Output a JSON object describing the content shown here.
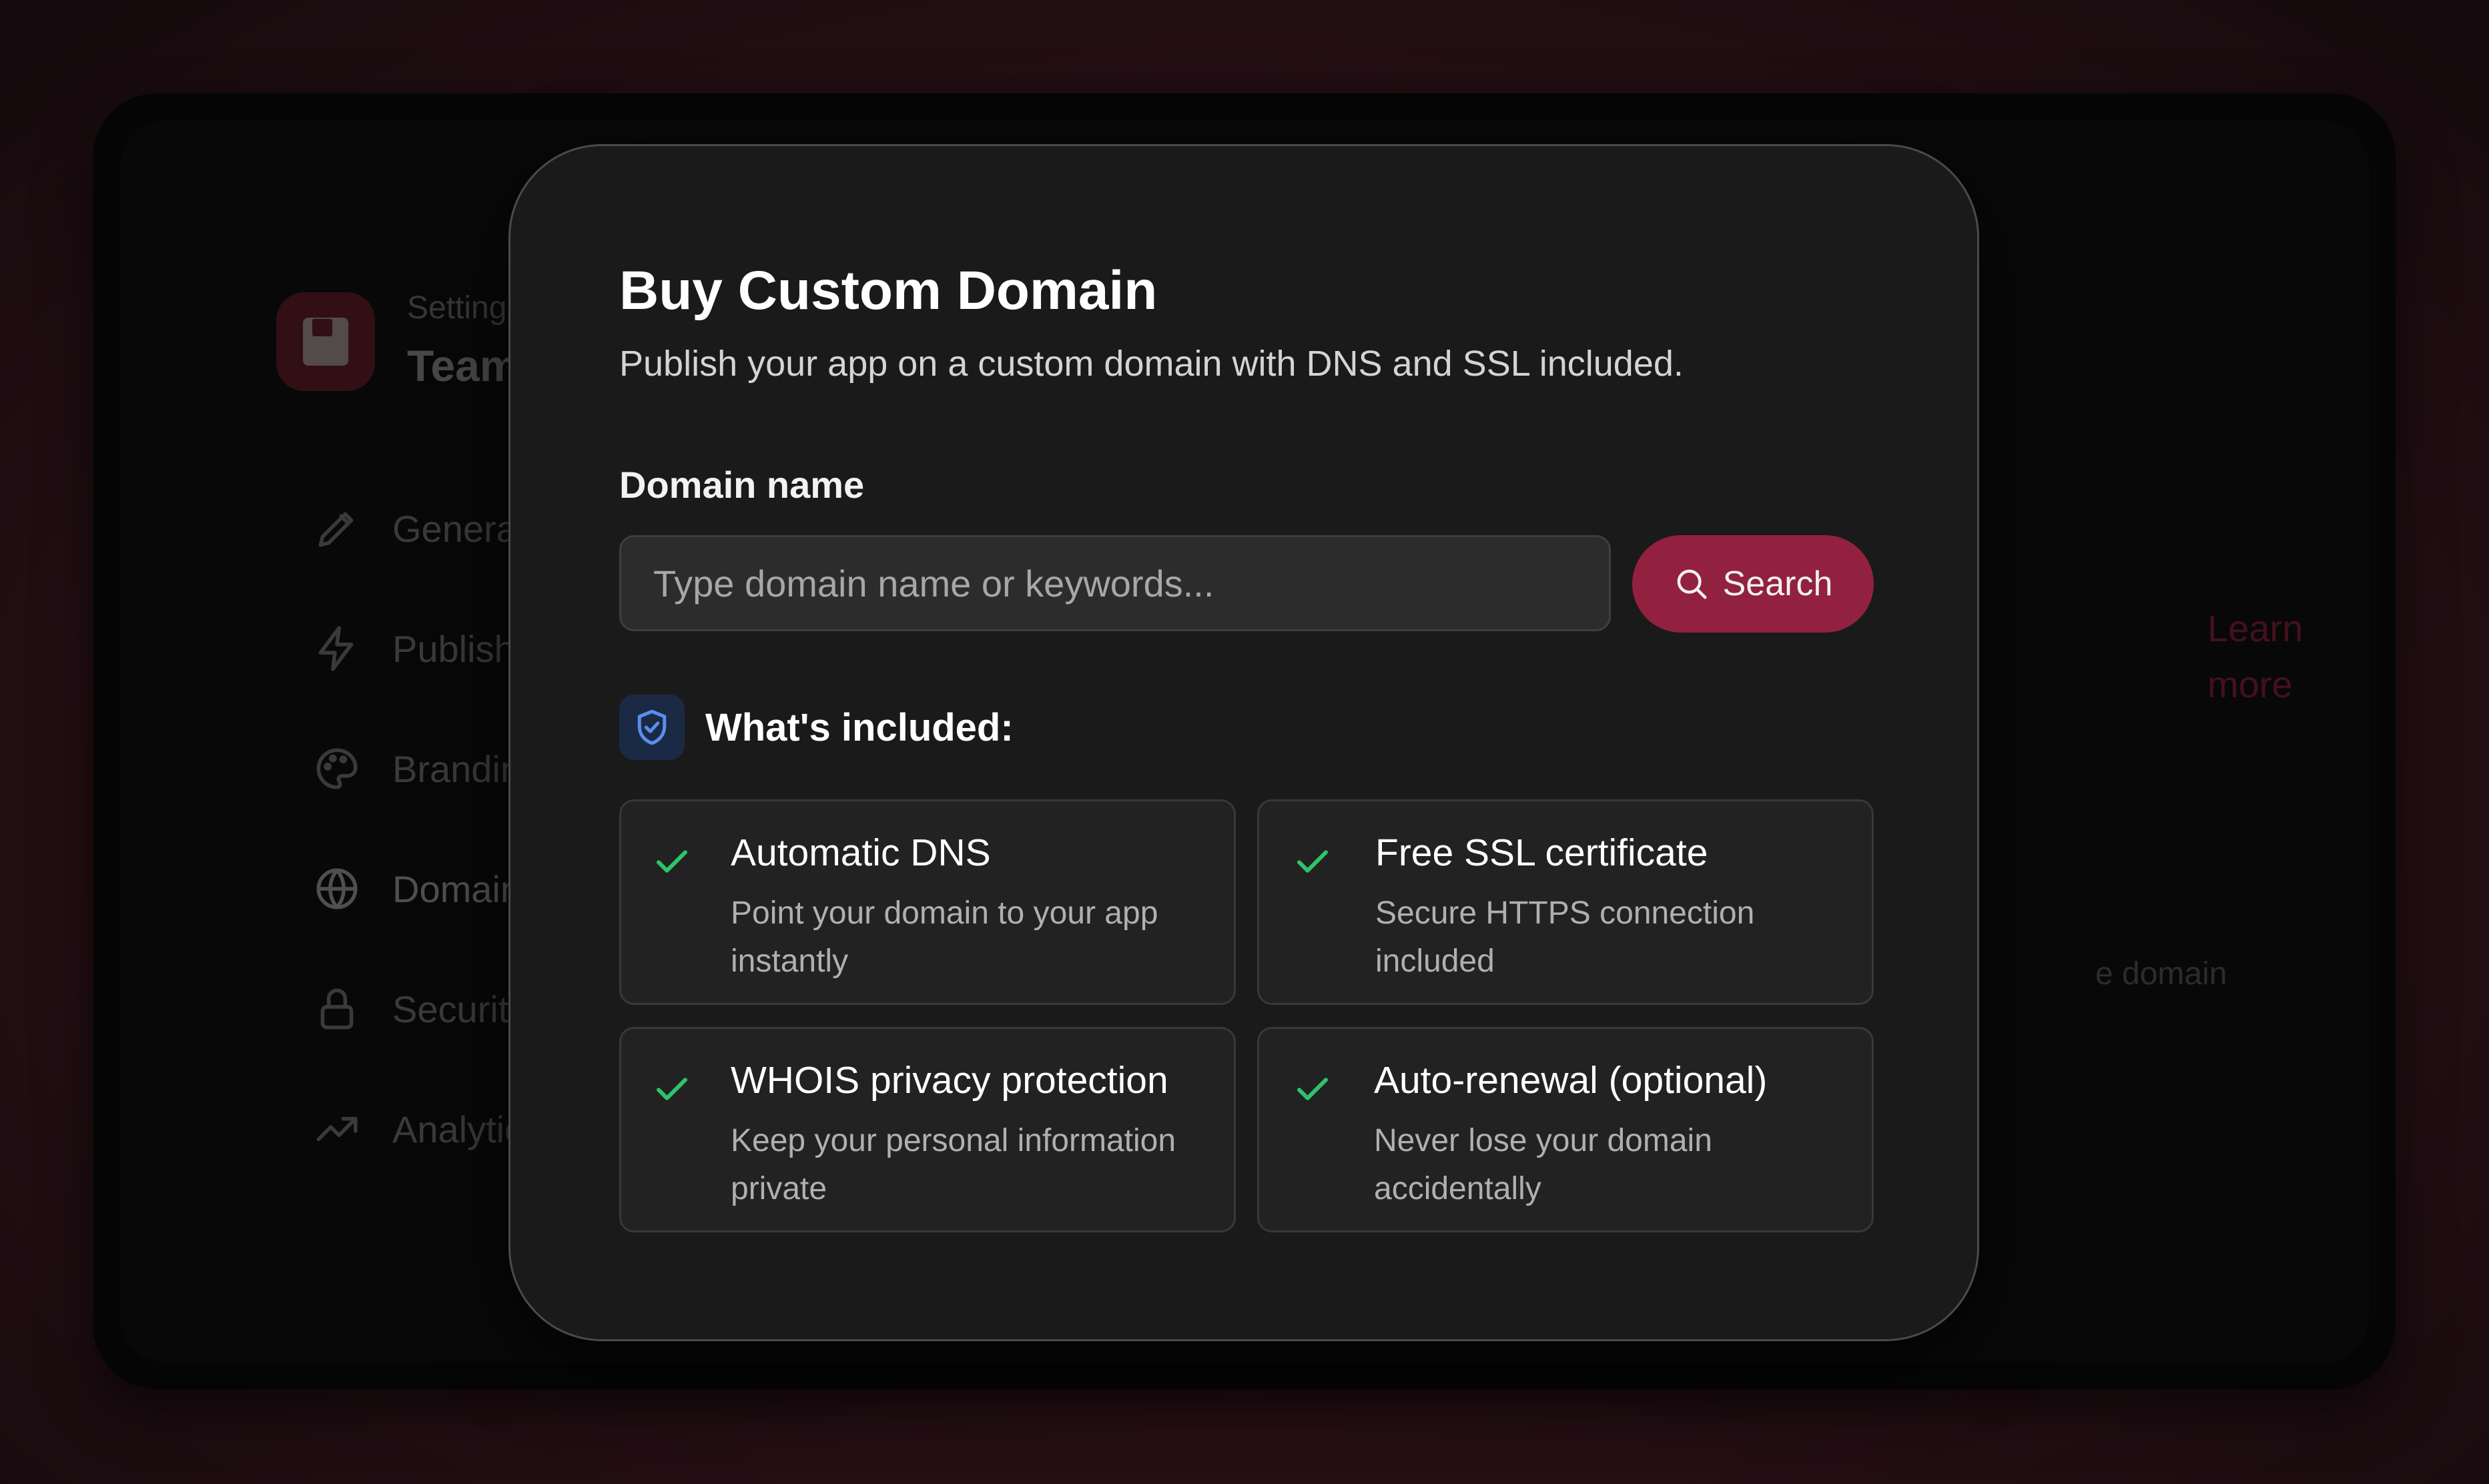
{
  "background_app": {
    "breadcrumb": "Settings",
    "title": "Team Capa",
    "nav": [
      {
        "label": "General",
        "icon": "pencil-icon"
      },
      {
        "label": "Publish",
        "icon": "lightning-icon"
      },
      {
        "label": "Branding",
        "icon": "palette-icon"
      },
      {
        "label": "Domains",
        "icon": "globe-icon"
      },
      {
        "label": "Security",
        "icon": "lock-icon"
      },
      {
        "label": "Analytics",
        "icon": "trending-up-icon"
      }
    ],
    "learn_more": "Learn more",
    "partial_text": "e domain"
  },
  "modal": {
    "title": "Buy Custom Domain",
    "subtitle": "Publish your app on a custom domain with DNS and SSL included.",
    "domain_label": "Domain name",
    "domain_placeholder": "Type domain name or keywords...",
    "domain_value": "",
    "search_label": "Search",
    "included_heading": "What's included:",
    "features": [
      {
        "title": "Automatic DNS",
        "description": "Point your domain to your app instantly"
      },
      {
        "title": "Free SSL certificate",
        "description": "Secure HTTPS connection included"
      },
      {
        "title": "WHOIS privacy protection",
        "description": "Keep your personal information private"
      },
      {
        "title": "Auto-renewal (optional)",
        "description": "Never lose your domain accidentally"
      }
    ]
  },
  "colors": {
    "accent": "#92213f",
    "check": "#2fc36a",
    "shield": "#5b8def",
    "modal_bg": "#1a1a1a"
  }
}
